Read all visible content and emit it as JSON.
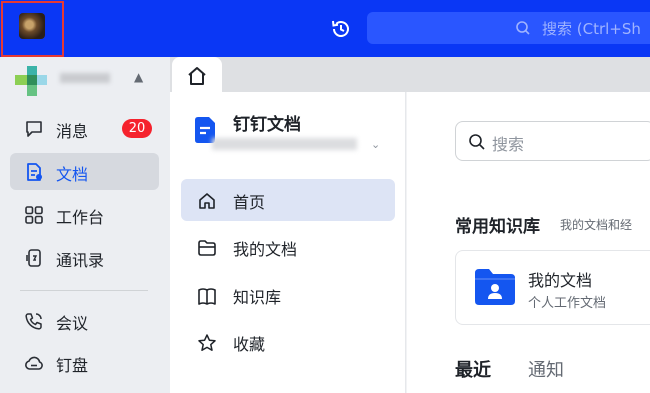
{
  "topbar": {
    "search_placeholder": "搜索 (Ctrl+Sh",
    "accent": "#0a37f5"
  },
  "sidebar": {
    "items": [
      {
        "label": "消息",
        "icon": "message-icon",
        "badge": "20"
      },
      {
        "label": "文档",
        "icon": "doc-icon",
        "active": true
      },
      {
        "label": "工作台",
        "icon": "workbench-icon"
      },
      {
        "label": "通讯录",
        "icon": "contacts-icon"
      },
      {
        "label": "会议",
        "icon": "meeting-icon"
      },
      {
        "label": "钉盘",
        "icon": "cloud-drive-icon"
      }
    ]
  },
  "docs_app": {
    "title": "钉钉文档",
    "nav": [
      {
        "label": "首页",
        "icon": "home-icon",
        "active": true
      },
      {
        "label": "我的文档",
        "icon": "folder-icon"
      },
      {
        "label": "知识库",
        "icon": "book-icon"
      },
      {
        "label": "收藏",
        "icon": "star-icon"
      }
    ]
  },
  "main": {
    "search_placeholder": "搜索",
    "kb_title": "常用知识库",
    "kb_subtitle": "我的文档和经",
    "card": {
      "title": "我的文档",
      "subtitle": "个人工作文档",
      "icon": "folder-user-icon"
    },
    "tabs": [
      "最近",
      "通知"
    ]
  },
  "colors": {
    "brand_blue": "#1456f0",
    "badge_red": "#f5222d",
    "highlight_red": "#e53935"
  }
}
